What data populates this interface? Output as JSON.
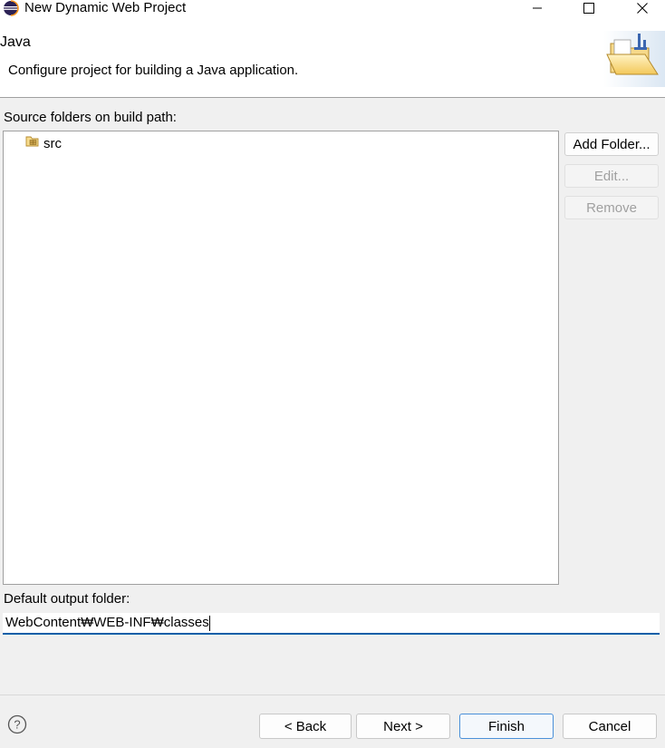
{
  "window": {
    "title": "New Dynamic Web Project",
    "app_icon": "eclipse-icon",
    "controls": [
      "minimize-icon",
      "maximize-icon",
      "close-icon"
    ]
  },
  "header": {
    "heading": "Java",
    "description": "Configure project for building a Java application.",
    "banner_icon": "java-folder-wizard-icon"
  },
  "source_folders": {
    "label": "Source folders on build path:",
    "items": [
      {
        "label": "src",
        "icon": "package-folder-icon"
      }
    ],
    "buttons": {
      "add_folder": "Add Folder...",
      "edit": "Edit...",
      "remove": "Remove"
    }
  },
  "output": {
    "label": "Default output folder:",
    "value": "WebContent₩WEB-INF₩classes"
  },
  "footer": {
    "help_icon": "help-icon",
    "back": "< Back",
    "next": "Next >",
    "finish": "Finish",
    "cancel": "Cancel"
  },
  "colors": {
    "accent": "#0a5fa8",
    "focus_border": "#4a90d9",
    "disabled_text": "#a0a0a0"
  }
}
